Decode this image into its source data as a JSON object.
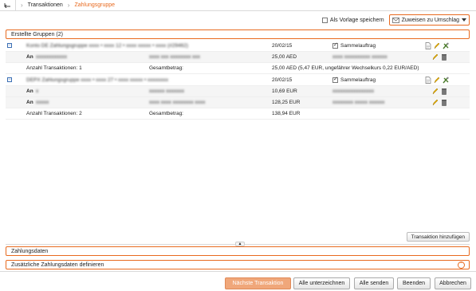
{
  "breadcrumb": {
    "items": [
      "Transaktionen",
      "Zahlungsgruppe"
    ]
  },
  "toolbar": {
    "save_template_label": "Als Vorlage speichern",
    "assign_label": "Zuweisen zu Umschlag"
  },
  "groups_header": "Erstellte Gruppen (2)",
  "groups": [
    {
      "header": {
        "text": "Konto DE Zahlungsgruppe xxxx • xxxx 12 • xxxx xxxxx • xxxx (#29462)",
        "date": "20/02/15",
        "sammel_label": "Sammelauftrag"
      },
      "rows": [
        {
          "label": "An",
          "name": "xxxxxxxxxxxx",
          "account": "xxxx xxx xxxxxxxx xxx",
          "amount": "25,00 AED",
          "ref": "xxxx xxxxxxxxxx xxxxxx"
        }
      ],
      "summary": {
        "count_label": "Anzahl Transaktionen: 1",
        "total_label": "Gesamtbetrag:",
        "total_value": "25,00 AED (5,47 EUR, ungefährer Wechselkurs 0,22 EUR/AED)"
      }
    },
    {
      "header": {
        "text": "DEPX Zahlungsgruppe xxxx • xxxx 27 • xxxx xxxxx • xxxxxxxx",
        "date": "20/02/15",
        "sammel_label": "Sammelauftrag"
      },
      "rows": [
        {
          "label": "An",
          "name": "x",
          "account": "xxxxxx xxxxxxx",
          "amount": "10,69 EUR",
          "ref": "xxxxxxxxxxxxxxxx"
        },
        {
          "label": "An",
          "name": "xxxxx",
          "account": "xxxx xxxx xxxxxxxx xxxx",
          "amount": "128,25 EUR",
          "ref": "xxxxxxxx xxxxx xxxxxx"
        }
      ],
      "summary": {
        "count_label": "Anzahl Transaktionen: 2",
        "total_label": "Gesamtbetrag:",
        "total_value": "138,94 EUR"
      }
    }
  ],
  "add_transaction_label": "Transaktion hinzufügen",
  "payment_data_label": "Zahlungsdaten",
  "additional_data_label": "Zusätzliche Zahlungsdaten definieren",
  "footer": {
    "next_label": "Nächste Transaktion",
    "sign_all_label": "Alle unterzeichnen",
    "send_all_label": "Alle senden",
    "finish_label": "Beenden",
    "cancel_label": "Abbrechen"
  },
  "colors": {
    "accent": "#e86a1f",
    "link": "#3b6fb4"
  }
}
